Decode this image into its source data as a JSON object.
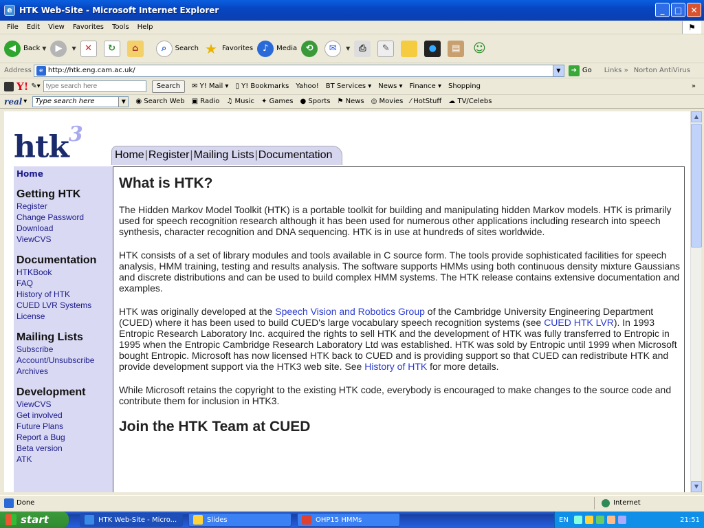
{
  "window": {
    "title": "HTK Web-Site - Microsoft Internet Explorer"
  },
  "menu": [
    "File",
    "Edit",
    "View",
    "Favorites",
    "Tools",
    "Help"
  ],
  "toolbar": {
    "back": "Back",
    "search": "Search",
    "favorites": "Favorites",
    "media": "Media"
  },
  "address": {
    "label": "Address",
    "url": "http://htk.eng.cam.ac.uk/",
    "go": "Go",
    "links": "Links",
    "norton": "Norton AntiVirus"
  },
  "yahoo": {
    "placeholder": "type search here",
    "search_btn": "Search",
    "items": [
      "Y! Mail",
      "Y! Bookmarks",
      "Yahoo!",
      "BT Services",
      "News",
      "Finance",
      "Shopping"
    ]
  },
  "real": {
    "logo": "real",
    "placeholder": "Type search here",
    "search_web": "Search Web",
    "items": [
      "Radio",
      "Music",
      "Games",
      "Sports",
      "News",
      "Movies",
      "HotStuff",
      "TV/Celebs"
    ]
  },
  "page": {
    "logo": "htk",
    "logo_sup": "3",
    "nav": [
      "Home",
      "Register",
      "Mailing Lists",
      "Documentation"
    ],
    "sidebar": {
      "home": "Home",
      "sections": [
        {
          "title": "Getting HTK",
          "links": [
            "Register",
            "Change Password",
            "Download",
            "ViewCVS"
          ]
        },
        {
          "title": "Documentation",
          "links": [
            "HTKBook",
            "FAQ",
            "History of HTK",
            "CUED LVR Systems",
            "License"
          ]
        },
        {
          "title": "Mailing Lists",
          "links": [
            "Subscribe",
            "Account/Unsubscribe",
            "Archives"
          ]
        },
        {
          "title": "Development",
          "links": [
            "ViewCVS",
            "Get involved",
            "Future Plans",
            "Report a Bug",
            "Beta version",
            "ATK"
          ]
        }
      ]
    },
    "heading": "What is HTK?",
    "p1": "The Hidden Markov Model Toolkit (HTK) is a portable toolkit for building and manipulating hidden Markov models. HTK is primarily used for speech recognition research although it has been used for numerous other applications including research into speech synthesis, character recognition and DNA sequencing. HTK is in use at hundreds of sites worldwide.",
    "p2": "HTK consists of a set of library modules and tools available in C source form. The tools provide sophisticated facilities for speech analysis, HMM training, testing and results analysis. The software supports HMMs using both continuous density mixture Gaussians and discrete distributions and can be used to build complex HMM systems. The HTK release contains extensive documentation and examples.",
    "p3_a": "HTK was originally developed at the ",
    "p3_link1": "Speech Vision and Robotics Group",
    "p3_b": " of the Cambridge University Engineering Department (CUED) where it has been used to build CUED's large vocabulary speech recognition systems (see ",
    "p3_link2": "CUED HTK LVR",
    "p3_c": "). In 1993 Entropic Research Laboratory Inc. acquired the rights to sell HTK and the development of HTK was fully transferred to Entropic in 1995 when the Entropic Cambridge Research Laboratory Ltd was established. HTK was sold by Entropic until 1999 when Microsoft bought Entropic. Microsoft has now licensed HTK back to CUED and is providing support so that CUED can redistribute HTK and provide development support via the HTK3 web site. See ",
    "p3_link3": "History of HTK",
    "p3_d": " for more details.",
    "p4": "While Microsoft retains the copyright to the existing HTK code, everybody is encouraged to make changes to the source code and contribute them for inclusion in HTK3.",
    "heading2": "Join the HTK Team at CUED"
  },
  "status": {
    "text": "Done",
    "zone": "Internet"
  },
  "taskbar": {
    "start": "start",
    "tasks": [
      "HTK Web-Site - Micro...",
      "Slides",
      "OHP15 HMMs"
    ],
    "lang": "EN",
    "clock": "21:51"
  },
  "colors": {
    "titlebar": "#0a46c2",
    "sidebar": "#d9d9f3",
    "link": "#2a3ad0",
    "navtab": "#d6d6ee"
  }
}
